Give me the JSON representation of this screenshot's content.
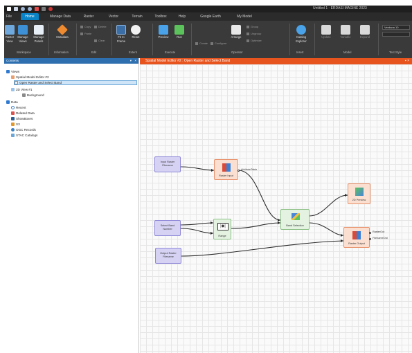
{
  "app": {
    "title": "Untitled 1 - ERDAS IMAGINE 2023"
  },
  "menu": {
    "tabs": [
      "File",
      "Home",
      "Manage Data",
      "Raster",
      "Vector",
      "Terrain",
      "Toolbox",
      "Help",
      "Google Earth",
      "My Model"
    ]
  },
  "ribbon": {
    "buttons": [
      {
        "label": "Raster",
        "sub": "View"
      },
      {
        "label": "Manage",
        "sub": "Views"
      },
      {
        "label": "Manage",
        "sub": "Panels"
      },
      {
        "label": "Metadata",
        "sub": ""
      },
      {
        "label": "Fit to",
        "sub": "Frame"
      },
      {
        "label": "Reset",
        "sub": ""
      },
      {
        "label": "Preview",
        "sub": ""
      },
      {
        "label": "Run",
        "sub": ""
      },
      {
        "label": "Arrange",
        "sub": ""
      },
      {
        "label": "Catalog",
        "sub": "Explorer"
      }
    ],
    "small_items": [
      "Copy",
      "Paste",
      "Delete",
      "Clear",
      "Configure",
      "Create",
      "Subsume",
      "Expand",
      "Group",
      "Ungroup",
      "Optimize",
      "Update",
      "Variable"
    ],
    "groups": [
      "Workspace",
      "Information",
      "Edit",
      "Extent",
      "Execute",
      "Operator",
      "Insert",
      "Model",
      "Text Style"
    ],
    "combo_value": "Verdana 10"
  },
  "left_panel": {
    "title": "Contents",
    "tree": [
      {
        "label": "Views",
        "level": 0
      },
      {
        "label": "Spatial Model Editor #2",
        "level": 1
      },
      {
        "label": "Open Raster and Select Band",
        "level": 2,
        "selected": true
      },
      {
        "label": "2D View #1",
        "level": 1
      },
      {
        "label": "Background",
        "level": 2
      },
      {
        "label": "Data",
        "level": 0
      },
      {
        "label": "Recent",
        "level": 1
      },
      {
        "label": "Related Data",
        "level": 1
      },
      {
        "label": "ShowBoxes",
        "level": 1
      },
      {
        "label": "S3",
        "level": 1
      },
      {
        "label": "OGC Records",
        "level": 1
      },
      {
        "label": "STAC Catalogs",
        "level": 1
      }
    ]
  },
  "editor": {
    "tab_title": "Spatial Model Editor #2 : Open Raster and Select Band",
    "nodes": {
      "input_raster": {
        "line1": "Input Raster",
        "line2": "Filename"
      },
      "raster_input": {
        "label": "Raster Input"
      },
      "attribute_table": "AttributeTable",
      "select_band": {
        "line1": "Select Band",
        "line2": "Number"
      },
      "range": {
        "label": "Range"
      },
      "band_selection": {
        "label": "Band Selection"
      },
      "two_d_preview": {
        "label": "2D Preview"
      },
      "raster_output": {
        "label": "Raster Output"
      },
      "raster_out_port": "RasterOut",
      "filename_out_port": "FilenameOut",
      "output_raster": {
        "line1": "Output Raster",
        "line2": "Filename"
      }
    }
  },
  "colors": {
    "accent": "#0a84c6",
    "editor_tab": "#e8541e",
    "panel_head": "#2e6fb0"
  }
}
